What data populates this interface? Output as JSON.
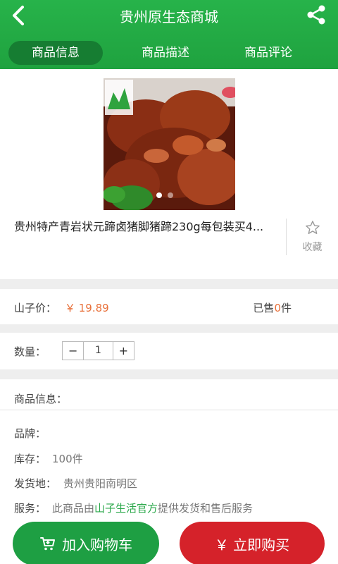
{
  "header": {
    "title": "贵州原生态商城"
  },
  "tabs": [
    {
      "label": "商品信息"
    },
    {
      "label": "商品描述"
    },
    {
      "label": "商品评论"
    }
  ],
  "product": {
    "name": "贵州特产青岩状元蹄卤猪脚猪蹄230g每包装买4...",
    "favorite_label": "收藏"
  },
  "price": {
    "label": "山子价：",
    "value": "￥ 19.89",
    "sold_prefix": "已售",
    "sold_count": "0",
    "sold_suffix": "件"
  },
  "quantity": {
    "label": "数量：",
    "minus": "−",
    "value": "1",
    "plus": "+"
  },
  "info": {
    "title": "商品信息：",
    "brand_label": "品牌：",
    "stock_label": "库存：",
    "stock_value": "100件",
    "ship_label": "发货地：",
    "ship_value": "贵州贵阳南明区",
    "service_label": "服务：",
    "service_pre": "此商品由",
    "service_link": "山子生活官方",
    "service_post": "提供发货和售后服务"
  },
  "actions": {
    "cart_label": "加入购物车",
    "buy_label": "￥ 立即购买"
  },
  "colors": {
    "brand_green": "#1fa23f",
    "price_orange": "#e8703a",
    "buy_red": "#d5222a"
  }
}
